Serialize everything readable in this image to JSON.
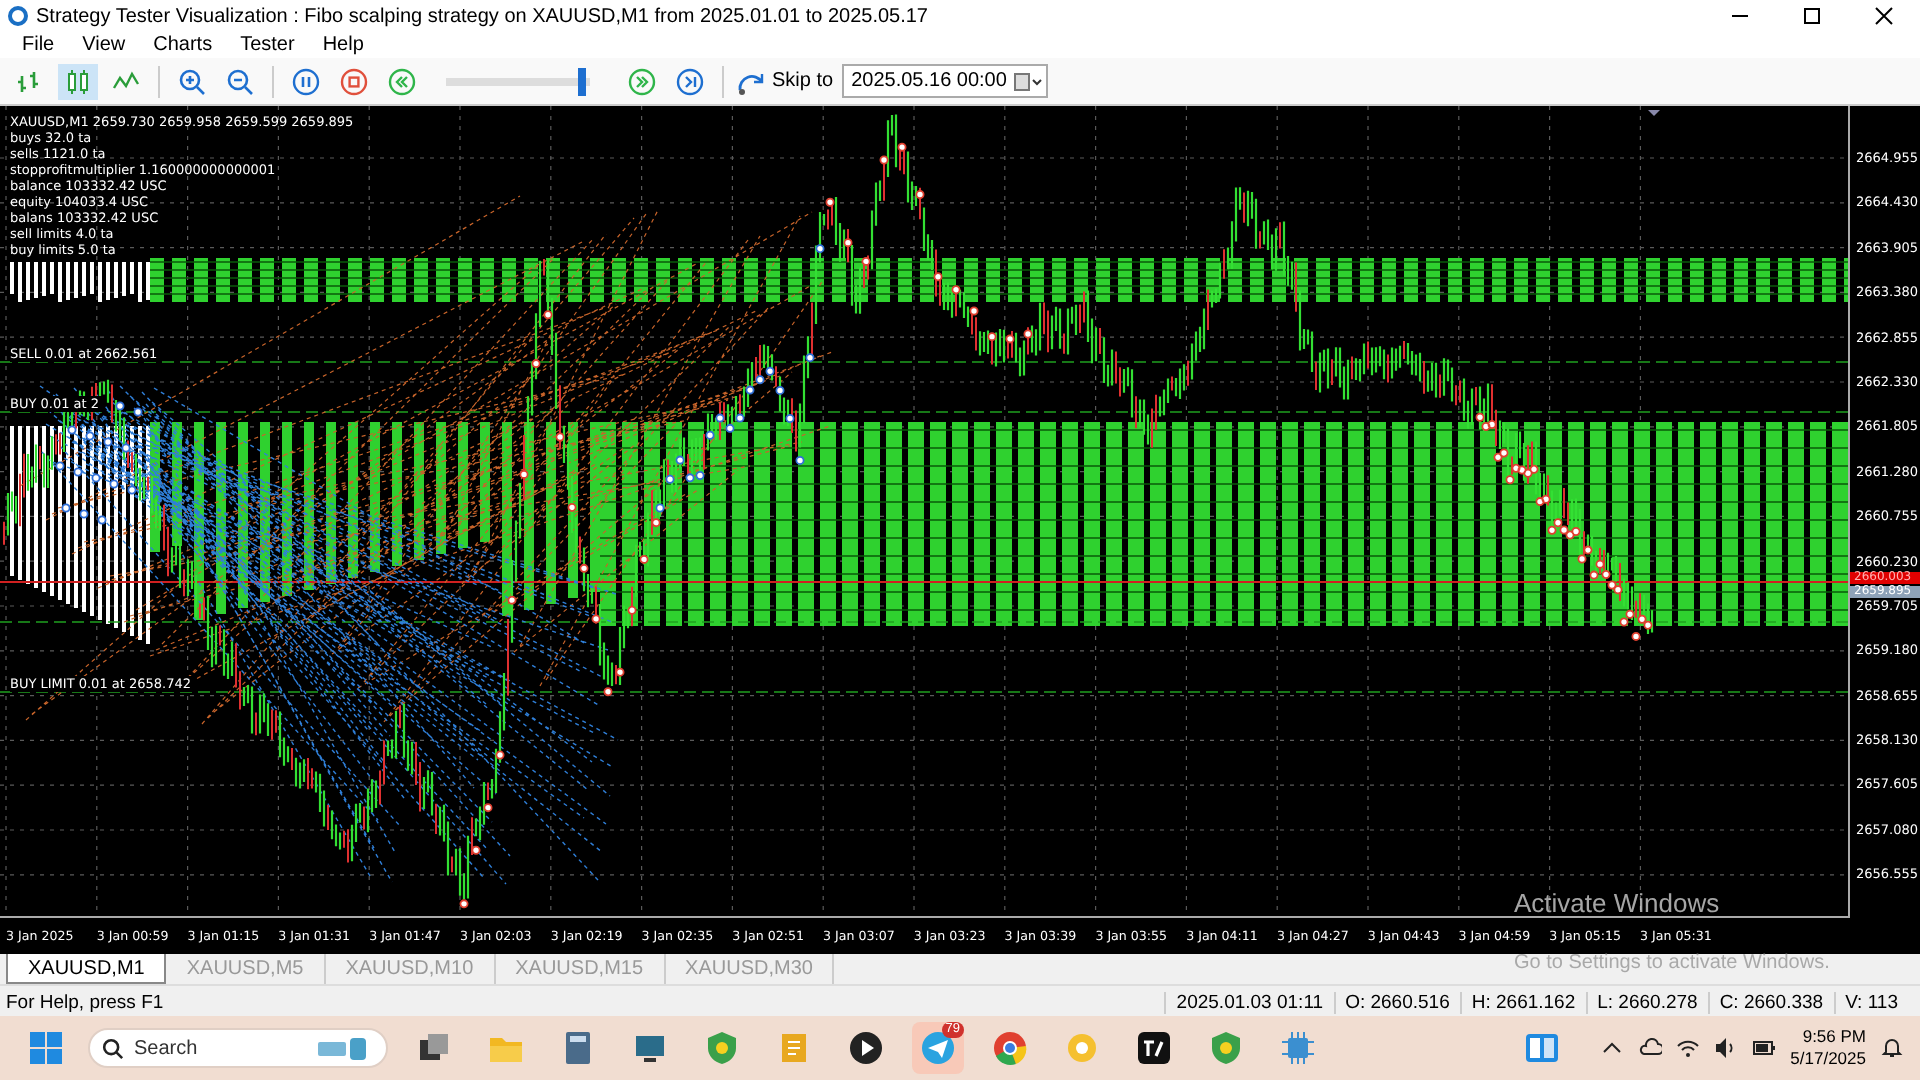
{
  "window": {
    "title": "Strategy Tester Visualization : Fibo scalping strategy on XAUUSD,M1 from 2025.01.01 to 2025.05.17"
  },
  "menu": [
    "File",
    "View",
    "Charts",
    "Tester",
    "Help"
  ],
  "toolbar": {
    "chart_types": [
      {
        "kind": "bars",
        "selected": false
      },
      {
        "kind": "candles",
        "selected": true
      },
      {
        "kind": "line",
        "selected": false
      }
    ],
    "playback": {
      "level": 0.95
    },
    "skip_to": {
      "label": "Skip to",
      "value": "2025.05.16 00:00"
    }
  },
  "chart": {
    "info_lines": [
      "XAUUSD,M1  2659.730 2659.958 2659.599 2659.895",
      "buys 32.0 ta",
      "sells 1121.0 ta",
      "stopprofitmultiplier 1.160000000000001",
      "balance 103332.42 USC",
      "equity 104033.4 USC",
      "balans 103332.42 USC",
      "sell limits 4.0 ta",
      "buy limits 5.0 ta"
    ],
    "order_labels": [
      "SELL 0.01 at 2662.561",
      "BUY 0.01 at 2",
      "BUY LIMIT 0.01 at 2658.742"
    ],
    "price_axis": [
      "2664.955",
      "2664.430",
      "2663.905",
      "2663.380",
      "2662.855",
      "2662.330",
      "2661.805",
      "2661.280",
      "2660.755",
      "2660.230",
      "2659.705",
      "2659.180",
      "2658.655",
      "2658.130",
      "2657.605",
      "2657.080",
      "2656.555"
    ],
    "price_tags": [
      {
        "kind": "level",
        "text": "2660.003"
      },
      {
        "kind": "price",
        "text": "2659.895"
      }
    ],
    "time_axis": [
      "3 Jan 2025",
      "3 Jan 00:59",
      "3 Jan 01:15",
      "3 Jan 01:31",
      "3 Jan 01:47",
      "3 Jan 02:03",
      "3 Jan 02:19",
      "3 Jan 02:35",
      "3 Jan 02:51",
      "3 Jan 03:07",
      "3 Jan 03:23",
      "3 Jan 03:39",
      "3 Jan 03:55",
      "3 Jan 04:11",
      "3 Jan 04:27",
      "3 Jan 04:43",
      "3 Jan 04:59",
      "3 Jan 05:15",
      "3 Jan 05:31"
    ]
  },
  "tabs": [
    {
      "label": "XAUUSD,M1",
      "selected": true
    },
    {
      "label": "XAUUSD,M5",
      "selected": false
    },
    {
      "label": "XAUUSD,M10",
      "selected": false
    },
    {
      "label": "XAUUSD,M15",
      "selected": false
    },
    {
      "label": "XAUUSD,M30",
      "selected": false
    }
  ],
  "status_bar": {
    "help": "For Help, press F1",
    "cells": [
      "2025.01.03 01:11",
      "O: 2660.516",
      "H: 2661.162",
      "L: 2660.278",
      "C: 2660.338",
      "V: 113"
    ]
  },
  "os_notice": [
    "Activate Windows",
    "Go to Settings to activate Windows."
  ],
  "taskbar": {
    "search": {
      "placeholder": "Search"
    },
    "badge": "79",
    "clock": {
      "time": "9:56 PM",
      "date": "5/17/2025"
    }
  }
}
